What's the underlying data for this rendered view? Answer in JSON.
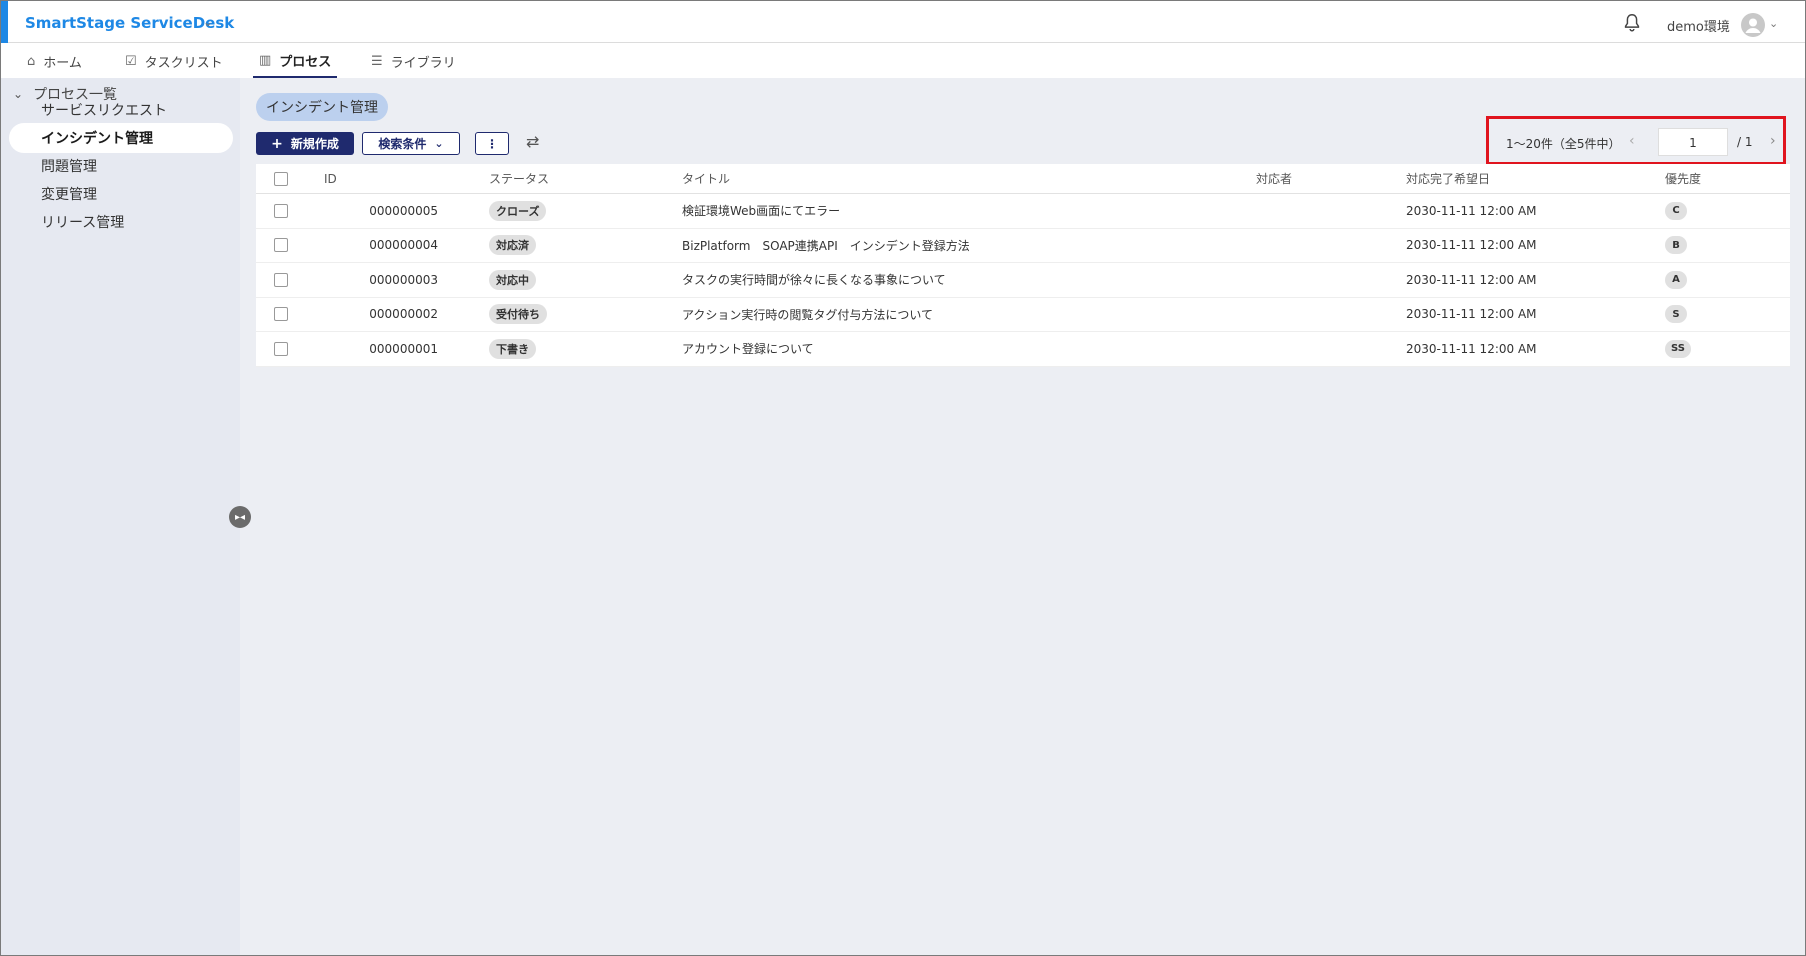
{
  "header": {
    "app_title": "SmartStage ServiceDesk",
    "environment": "demo環境"
  },
  "tabs": [
    {
      "label": "ホーム",
      "icon": "home-icon"
    },
    {
      "label": "タスクリスト",
      "icon": "checklist-icon"
    },
    {
      "label": "プロセス",
      "icon": "process-icon",
      "active": true
    },
    {
      "label": "ライブラリ",
      "icon": "library-icon"
    }
  ],
  "sidebar": {
    "group_label": "プロセス一覧",
    "items": [
      {
        "label": "サービスリクエスト"
      },
      {
        "label": "インシデント管理",
        "active": true
      },
      {
        "label": "問題管理"
      },
      {
        "label": "変更管理"
      },
      {
        "label": "リリース管理"
      }
    ]
  },
  "main": {
    "chip": "インシデント管理",
    "new_button": "新規作成",
    "search_button": "検索条件",
    "pager": {
      "range": "1〜20件（全5件中）",
      "page": "1",
      "total": "/ 1"
    },
    "columns": {
      "id": "ID",
      "status": "ステータス",
      "title": "タイトル",
      "assignee": "対応者",
      "due": "対応完了希望日",
      "priority": "優先度"
    },
    "rows": [
      {
        "id": "000000005",
        "status": "クローズ",
        "title": "検証環境Web画面にてエラー",
        "assignee": "",
        "due": "2030-11-11 12:00 AM",
        "priority": "C"
      },
      {
        "id": "000000004",
        "status": "対応済",
        "title": "BizPlatform　SOAP連携API　インシデント登録方法",
        "assignee": "",
        "due": "2030-11-11 12:00 AM",
        "priority": "B"
      },
      {
        "id": "000000003",
        "status": "対応中",
        "title": "タスクの実行時間が徐々に長くなる事象について",
        "assignee": "",
        "due": "2030-11-11 12:00 AM",
        "priority": "A"
      },
      {
        "id": "000000002",
        "status": "受付待ち",
        "title": "アクション実行時の閲覧タグ付与方法について",
        "assignee": "",
        "due": "2030-11-11 12:00 AM",
        "priority": "S"
      },
      {
        "id": "000000001",
        "status": "下書き",
        "title": "アカウント登録について",
        "assignee": "",
        "due": "2030-11-11 12:00 AM",
        "priority": "SS"
      }
    ]
  },
  "colors": {
    "brand": "#1e88e5",
    "primary_button": "#1f2a6e",
    "highlight_box": "#e0141e",
    "sidebar_bg": "#e6e9f1",
    "main_bg": "#eceef3"
  }
}
